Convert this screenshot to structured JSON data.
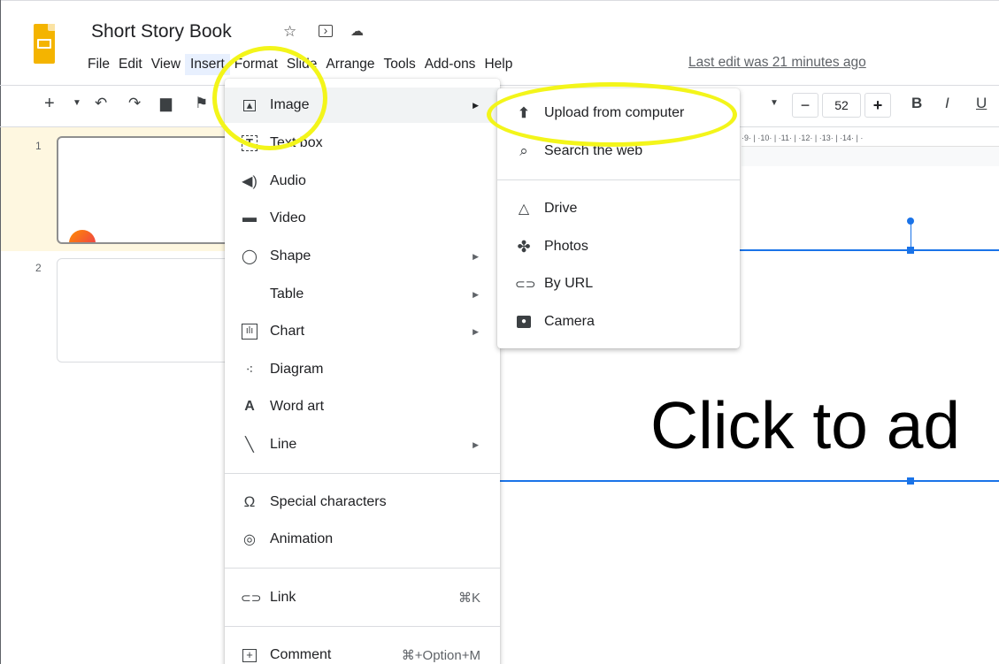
{
  "app": {
    "doc_title": "Short Story Book",
    "last_edit": "Last edit was 21 minutes ago",
    "accent": "#1a73e8",
    "logo_color": "#f4b400",
    "header_icons": [
      "star-icon",
      "move-to-folder-icon",
      "cloud-status-icon"
    ]
  },
  "menubar": [
    "File",
    "Edit",
    "View",
    "Insert",
    "Format",
    "Slide",
    "Arrange",
    "Tools",
    "Add-ons",
    "Help"
  ],
  "toolbar": {
    "font_size": "52",
    "minus": "−",
    "plus": "+",
    "bold": "B",
    "italic": "I",
    "underline": "U"
  },
  "ruler": "·9· | ·10· | ·11· | ·12· | ·13· | ·14· | ·",
  "slides": [
    {
      "number": "1"
    },
    {
      "number": "2"
    }
  ],
  "canvas": {
    "placeholder": "Click to ad"
  },
  "insert_menu": {
    "items": [
      {
        "label": "Image",
        "icon": "image-icon",
        "submenu": true
      },
      {
        "label": "Text box",
        "icon": "text-box-icon"
      },
      {
        "label": "Audio",
        "icon": "audio-icon"
      },
      {
        "label": "Video",
        "icon": "video-icon"
      },
      {
        "label": "Shape",
        "icon": "shape-icon",
        "submenu": true
      },
      {
        "label": "Table",
        "submenu": true
      },
      {
        "label": "Chart",
        "icon": "chart-icon",
        "submenu": true
      },
      {
        "label": "Diagram",
        "icon": "diagram-icon"
      },
      {
        "label": "Word art",
        "icon": "word-art-icon"
      },
      {
        "label": "Line",
        "icon": "line-icon",
        "submenu": true
      },
      {
        "label": "Special characters",
        "icon": "omega-icon"
      },
      {
        "label": "Animation",
        "icon": "animation-icon"
      },
      {
        "label": "Link",
        "icon": "link-icon",
        "shortcut": "⌘K"
      },
      {
        "label": "Comment",
        "icon": "comment-icon",
        "shortcut": "⌘+Option+M"
      }
    ]
  },
  "image_submenu": {
    "items": [
      {
        "label": "Upload from computer",
        "icon": "upload-icon"
      },
      {
        "label": "Search the web",
        "icon": "search-icon"
      },
      {
        "label": "Drive",
        "icon": "drive-icon"
      },
      {
        "label": "Photos",
        "icon": "photos-icon"
      },
      {
        "label": "By URL",
        "icon": "link-icon"
      },
      {
        "label": "Camera",
        "icon": "camera-icon"
      }
    ]
  },
  "annotation_color": "#f3f51a"
}
